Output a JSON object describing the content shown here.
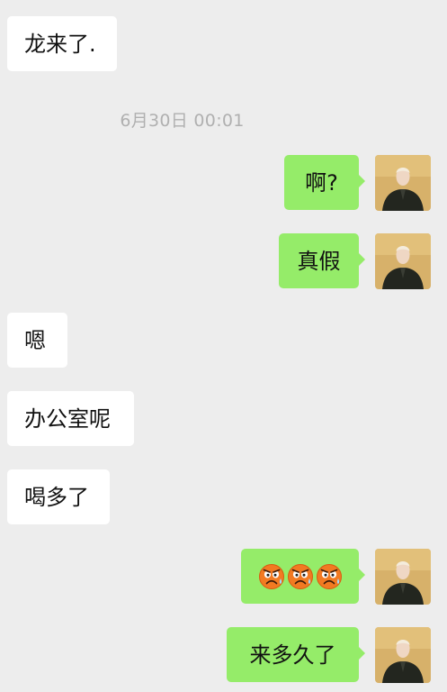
{
  "chat": {
    "timestamp": "6月30日 00:01",
    "messages": [
      {
        "side": "in",
        "text": "龙来了."
      },
      {
        "side": "out",
        "text": "啊?"
      },
      {
        "side": "out",
        "text": "真假"
      },
      {
        "side": "in",
        "text": "嗯"
      },
      {
        "side": "in",
        "text": "办公室呢"
      },
      {
        "side": "in",
        "text": "喝多了"
      },
      {
        "side": "out",
        "emoji": [
          "angry-sweat-emoji",
          "angry-sweat-emoji",
          "angry-sweat-emoji"
        ]
      },
      {
        "side": "out",
        "text": "来多久了"
      }
    ]
  },
  "colors": {
    "background": "#ededed",
    "incoming_bubble": "#ffffff",
    "outgoing_bubble": "#95ec69",
    "timestamp_text": "#b0b0b0"
  }
}
